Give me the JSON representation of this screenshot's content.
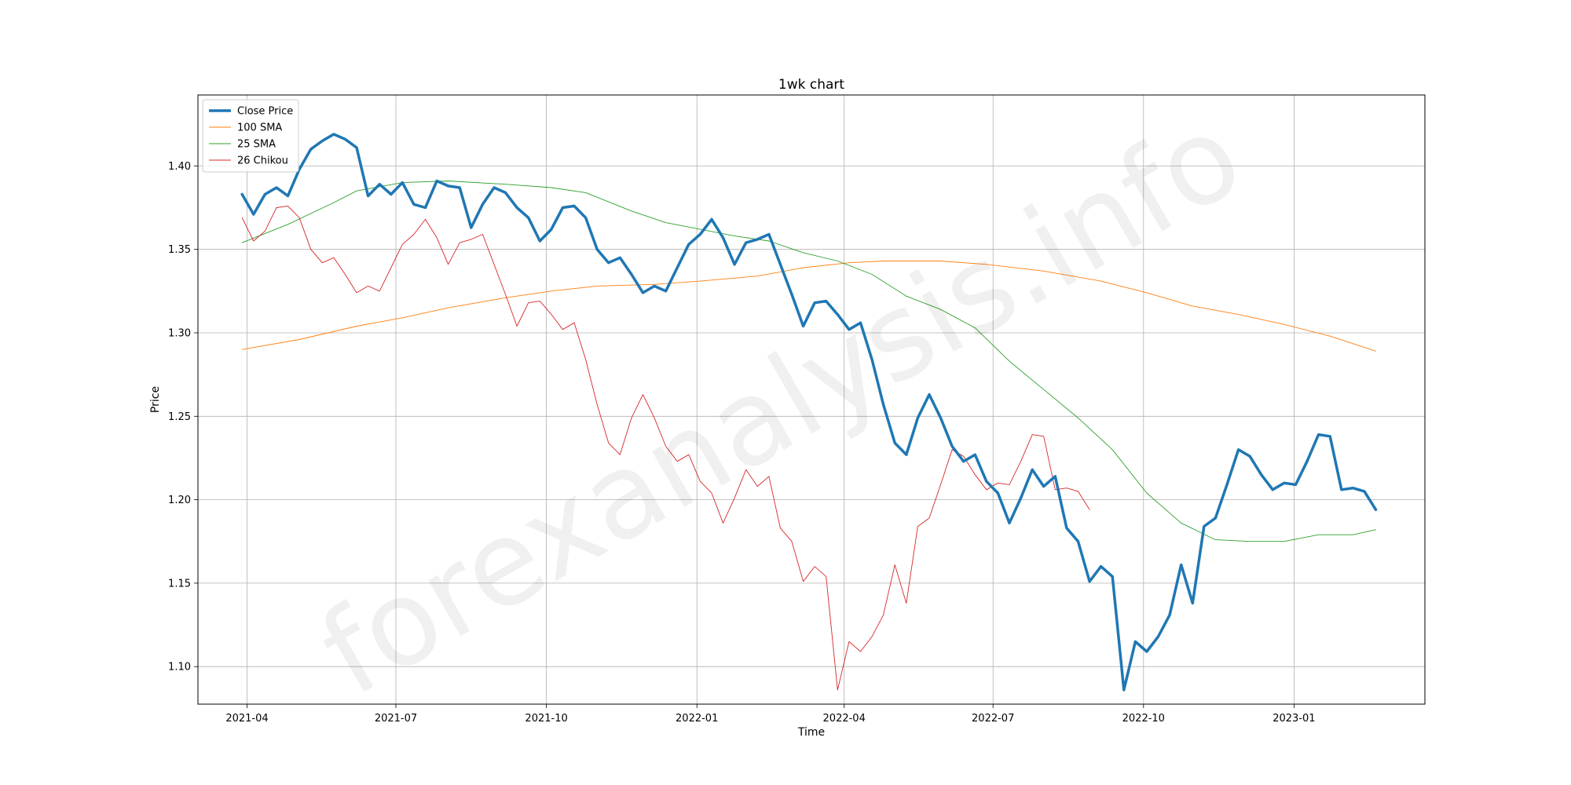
{
  "chart_data": {
    "type": "line",
    "title": "1wk chart",
    "xlabel": "Time",
    "ylabel": "Price",
    "xlim": [
      "2021-03-02",
      "2023-03-22"
    ],
    "ylim": [
      1.0775,
      1.4425
    ],
    "grid": true,
    "legend_position": "top-left",
    "watermark": "forexanalysis.info",
    "x_ticks": [
      {
        "date": "2021-04-01",
        "label": "2021-04"
      },
      {
        "date": "2021-07-01",
        "label": "2021-07"
      },
      {
        "date": "2021-10-01",
        "label": "2021-10"
      },
      {
        "date": "2022-01-01",
        "label": "2022-01"
      },
      {
        "date": "2022-04-01",
        "label": "2022-04"
      },
      {
        "date": "2022-07-01",
        "label": "2022-07"
      },
      {
        "date": "2022-10-01",
        "label": "2022-10"
      },
      {
        "date": "2023-01-01",
        "label": "2023-01"
      }
    ],
    "y_ticks": [
      {
        "value": 1.1,
        "label": "1.10"
      },
      {
        "value": 1.15,
        "label": "1.15"
      },
      {
        "value": 1.2,
        "label": "1.20"
      },
      {
        "value": 1.25,
        "label": "1.25"
      },
      {
        "value": 1.3,
        "label": "1.30"
      },
      {
        "value": 1.35,
        "label": "1.35"
      },
      {
        "value": 1.4,
        "label": "1.40"
      }
    ],
    "series": [
      {
        "name": "Close Price",
        "color": "#1f77b4",
        "width": 3.5,
        "points": [
          [
            "2021-03-29",
            1.383
          ],
          [
            "2021-04-05",
            1.371
          ],
          [
            "2021-04-12",
            1.383
          ],
          [
            "2021-04-19",
            1.387
          ],
          [
            "2021-04-26",
            1.382
          ],
          [
            "2021-05-03",
            1.398
          ],
          [
            "2021-05-10",
            1.41
          ],
          [
            "2021-05-17",
            1.415
          ],
          [
            "2021-05-24",
            1.419
          ],
          [
            "2021-05-31",
            1.416
          ],
          [
            "2021-06-07",
            1.411
          ],
          [
            "2021-06-14",
            1.382
          ],
          [
            "2021-06-21",
            1.389
          ],
          [
            "2021-06-28",
            1.383
          ],
          [
            "2021-07-05",
            1.39
          ],
          [
            "2021-07-12",
            1.377
          ],
          [
            "2021-07-19",
            1.375
          ],
          [
            "2021-07-26",
            1.391
          ],
          [
            "2021-08-02",
            1.388
          ],
          [
            "2021-08-09",
            1.387
          ],
          [
            "2021-08-16",
            1.363
          ],
          [
            "2021-08-23",
            1.377
          ],
          [
            "2021-08-30",
            1.387
          ],
          [
            "2021-09-06",
            1.384
          ],
          [
            "2021-09-13",
            1.375
          ],
          [
            "2021-09-20",
            1.369
          ],
          [
            "2021-09-27",
            1.355
          ],
          [
            "2021-10-04",
            1.362
          ],
          [
            "2021-10-11",
            1.375
          ],
          [
            "2021-10-18",
            1.376
          ],
          [
            "2021-10-25",
            1.369
          ],
          [
            "2021-11-01",
            1.35
          ],
          [
            "2021-11-08",
            1.342
          ],
          [
            "2021-11-15",
            1.345
          ],
          [
            "2021-11-22",
            1.335
          ],
          [
            "2021-11-29",
            1.324
          ],
          [
            "2021-12-06",
            1.328
          ],
          [
            "2021-12-13",
            1.325
          ],
          [
            "2021-12-20",
            1.339
          ],
          [
            "2021-12-27",
            1.353
          ],
          [
            "2022-01-03",
            1.359
          ],
          [
            "2022-01-10",
            1.368
          ],
          [
            "2022-01-17",
            1.357
          ],
          [
            "2022-01-24",
            1.341
          ],
          [
            "2022-01-31",
            1.354
          ],
          [
            "2022-02-07",
            1.356
          ],
          [
            "2022-02-14",
            1.359
          ],
          [
            "2022-02-21",
            1.341
          ],
          [
            "2022-02-28",
            1.323
          ],
          [
            "2022-03-07",
            1.304
          ],
          [
            "2022-03-14",
            1.318
          ],
          [
            "2022-03-21",
            1.319
          ],
          [
            "2022-03-28",
            1.311
          ],
          [
            "2022-04-04",
            1.302
          ],
          [
            "2022-04-11",
            1.306
          ],
          [
            "2022-04-18",
            1.284
          ],
          [
            "2022-04-25",
            1.257
          ],
          [
            "2022-05-02",
            1.234
          ],
          [
            "2022-05-09",
            1.227
          ],
          [
            "2022-05-16",
            1.249
          ],
          [
            "2022-05-23",
            1.263
          ],
          [
            "2022-05-30",
            1.249
          ],
          [
            "2022-06-06",
            1.232
          ],
          [
            "2022-06-13",
            1.223
          ],
          [
            "2022-06-20",
            1.227
          ],
          [
            "2022-06-27",
            1.211
          ],
          [
            "2022-07-04",
            1.204
          ],
          [
            "2022-07-11",
            1.186
          ],
          [
            "2022-07-18",
            1.201
          ],
          [
            "2022-07-25",
            1.218
          ],
          [
            "2022-08-01",
            1.208
          ],
          [
            "2022-08-08",
            1.214
          ],
          [
            "2022-08-15",
            1.183
          ],
          [
            "2022-08-22",
            1.175
          ],
          [
            "2022-08-29",
            1.151
          ],
          [
            "2022-09-05",
            1.16
          ],
          [
            "2022-09-12",
            1.154
          ],
          [
            "2022-09-19",
            1.086
          ],
          [
            "2022-09-26",
            1.115
          ],
          [
            "2022-10-03",
            1.109
          ],
          [
            "2022-10-10",
            1.118
          ],
          [
            "2022-10-17",
            1.131
          ],
          [
            "2022-10-24",
            1.161
          ],
          [
            "2022-10-31",
            1.138
          ],
          [
            "2022-11-07",
            1.184
          ],
          [
            "2022-11-14",
            1.189
          ],
          [
            "2022-11-21",
            1.209
          ],
          [
            "2022-11-28",
            1.23
          ],
          [
            "2022-12-05",
            1.226
          ],
          [
            "2022-12-12",
            1.215
          ],
          [
            "2022-12-19",
            1.206
          ],
          [
            "2022-12-26",
            1.21
          ],
          [
            "2023-01-02",
            1.209
          ],
          [
            "2023-01-09",
            1.223
          ],
          [
            "2023-01-16",
            1.239
          ],
          [
            "2023-01-23",
            1.238
          ],
          [
            "2023-01-30",
            1.206
          ],
          [
            "2023-02-06",
            1.207
          ],
          [
            "2023-02-13",
            1.205
          ],
          [
            "2023-02-20",
            1.194
          ]
        ]
      },
      {
        "name": "100 SMA",
        "color": "#ff7f0e",
        "width": 0.9,
        "points": [
          [
            "2021-03-29",
            1.29
          ],
          [
            "2021-05-03",
            1.296
          ],
          [
            "2021-06-07",
            1.304
          ],
          [
            "2021-07-05",
            1.309
          ],
          [
            "2021-08-02",
            1.315
          ],
          [
            "2021-09-06",
            1.321
          ],
          [
            "2021-10-04",
            1.325
          ],
          [
            "2021-11-01",
            1.328
          ],
          [
            "2021-12-06",
            1.329
          ],
          [
            "2022-01-03",
            1.331
          ],
          [
            "2022-02-07",
            1.334
          ],
          [
            "2022-03-07",
            1.339
          ],
          [
            "2022-04-04",
            1.342
          ],
          [
            "2022-04-25",
            1.343
          ],
          [
            "2022-05-30",
            1.343
          ],
          [
            "2022-06-27",
            1.341
          ],
          [
            "2022-08-01",
            1.337
          ],
          [
            "2022-09-05",
            1.331
          ],
          [
            "2022-10-03",
            1.324
          ],
          [
            "2022-10-31",
            1.316
          ],
          [
            "2022-11-28",
            1.311
          ],
          [
            "2022-12-26",
            1.305
          ],
          [
            "2023-01-23",
            1.298
          ],
          [
            "2023-02-20",
            1.289
          ]
        ]
      },
      {
        "name": "25 SMA",
        "color": "#2ca02c",
        "width": 0.9,
        "points": [
          [
            "2021-03-29",
            1.354
          ],
          [
            "2021-04-26",
            1.365
          ],
          [
            "2021-05-24",
            1.378
          ],
          [
            "2021-06-07",
            1.385
          ],
          [
            "2021-07-05",
            1.39
          ],
          [
            "2021-08-02",
            1.391
          ],
          [
            "2021-09-06",
            1.389
          ],
          [
            "2021-10-04",
            1.387
          ],
          [
            "2021-10-25",
            1.384
          ],
          [
            "2021-11-22",
            1.373
          ],
          [
            "2021-12-13",
            1.366
          ],
          [
            "2022-01-03",
            1.362
          ],
          [
            "2022-01-24",
            1.358
          ],
          [
            "2022-02-14",
            1.355
          ],
          [
            "2022-03-07",
            1.348
          ],
          [
            "2022-03-28",
            1.343
          ],
          [
            "2022-04-18",
            1.335
          ],
          [
            "2022-05-09",
            1.322
          ],
          [
            "2022-05-30",
            1.314
          ],
          [
            "2022-06-20",
            1.303
          ],
          [
            "2022-07-11",
            1.283
          ],
          [
            "2022-08-01",
            1.266
          ],
          [
            "2022-08-22",
            1.249
          ],
          [
            "2022-09-12",
            1.23
          ],
          [
            "2022-10-03",
            1.204
          ],
          [
            "2022-10-24",
            1.186
          ],
          [
            "2022-11-14",
            1.176
          ],
          [
            "2022-12-05",
            1.175
          ],
          [
            "2022-12-26",
            1.175
          ],
          [
            "2023-01-16",
            1.179
          ],
          [
            "2023-02-06",
            1.179
          ],
          [
            "2023-02-20",
            1.182
          ]
        ]
      },
      {
        "name": "26 Chikou",
        "color": "#d62728",
        "width": 0.9,
        "points": [
          [
            "2021-03-29",
            1.369
          ],
          [
            "2021-04-05",
            1.355
          ],
          [
            "2021-04-12",
            1.361
          ],
          [
            "2021-04-19",
            1.375
          ],
          [
            "2021-04-26",
            1.376
          ],
          [
            "2021-05-03",
            1.369
          ],
          [
            "2021-05-10",
            1.35
          ],
          [
            "2021-05-17",
            1.342
          ],
          [
            "2021-05-24",
            1.345
          ],
          [
            "2021-05-31",
            1.335
          ],
          [
            "2021-06-07",
            1.324
          ],
          [
            "2021-06-14",
            1.328
          ],
          [
            "2021-06-21",
            1.325
          ],
          [
            "2021-06-28",
            1.339
          ],
          [
            "2021-07-05",
            1.353
          ],
          [
            "2021-07-12",
            1.359
          ],
          [
            "2021-07-19",
            1.368
          ],
          [
            "2021-07-26",
            1.357
          ],
          [
            "2021-08-02",
            1.341
          ],
          [
            "2021-08-09",
            1.354
          ],
          [
            "2021-08-16",
            1.356
          ],
          [
            "2021-08-23",
            1.359
          ],
          [
            "2021-08-30",
            1.341
          ],
          [
            "2021-09-06",
            1.323
          ],
          [
            "2021-09-13",
            1.304
          ],
          [
            "2021-09-20",
            1.318
          ],
          [
            "2021-09-27",
            1.319
          ],
          [
            "2021-10-04",
            1.311
          ],
          [
            "2021-10-11",
            1.302
          ],
          [
            "2021-10-18",
            1.306
          ],
          [
            "2021-10-25",
            1.284
          ],
          [
            "2021-11-01",
            1.257
          ],
          [
            "2021-11-08",
            1.234
          ],
          [
            "2021-11-15",
            1.227
          ],
          [
            "2021-11-22",
            1.249
          ],
          [
            "2021-11-29",
            1.263
          ],
          [
            "2021-12-06",
            1.249
          ],
          [
            "2021-12-13",
            1.232
          ],
          [
            "2021-12-20",
            1.223
          ],
          [
            "2021-12-27",
            1.227
          ],
          [
            "2022-01-03",
            1.211
          ],
          [
            "2022-01-10",
            1.204
          ],
          [
            "2022-01-17",
            1.186
          ],
          [
            "2022-01-24",
            1.201
          ],
          [
            "2022-01-31",
            1.218
          ],
          [
            "2022-02-07",
            1.208
          ],
          [
            "2022-02-14",
            1.214
          ],
          [
            "2022-02-21",
            1.183
          ],
          [
            "2022-02-28",
            1.175
          ],
          [
            "2022-03-07",
            1.151
          ],
          [
            "2022-03-14",
            1.16
          ],
          [
            "2022-03-21",
            1.154
          ],
          [
            "2022-03-28",
            1.086
          ],
          [
            "2022-04-04",
            1.115
          ],
          [
            "2022-04-11",
            1.109
          ],
          [
            "2022-04-18",
            1.118
          ],
          [
            "2022-04-25",
            1.131
          ],
          [
            "2022-05-02",
            1.161
          ],
          [
            "2022-05-09",
            1.138
          ],
          [
            "2022-05-16",
            1.184
          ],
          [
            "2022-05-23",
            1.189
          ],
          [
            "2022-05-30",
            1.209
          ],
          [
            "2022-06-06",
            1.23
          ],
          [
            "2022-06-13",
            1.226
          ],
          [
            "2022-06-20",
            1.215
          ],
          [
            "2022-06-27",
            1.206
          ],
          [
            "2022-07-04",
            1.21
          ],
          [
            "2022-07-11",
            1.209
          ],
          [
            "2022-07-18",
            1.223
          ],
          [
            "2022-07-25",
            1.239
          ],
          [
            "2022-08-01",
            1.238
          ],
          [
            "2022-08-08",
            1.206
          ],
          [
            "2022-08-15",
            1.207
          ],
          [
            "2022-08-22",
            1.205
          ],
          [
            "2022-08-29",
            1.194
          ]
        ]
      }
    ]
  }
}
